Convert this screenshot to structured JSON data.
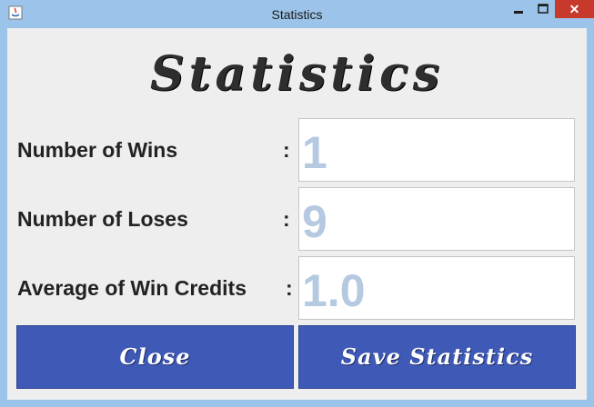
{
  "window": {
    "title": "Statistics",
    "close_glyph": "✕",
    "icons": [
      "java-app-icon",
      "minimize-icon",
      "maximize-icon",
      "close-icon"
    ]
  },
  "heading": "Statistics",
  "stats": [
    {
      "label": "Number of Wins",
      "colon": ":",
      "value": "1"
    },
    {
      "label": "Number of Loses",
      "colon": ":",
      "value": "9"
    },
    {
      "label": "Average of Win Credits",
      "colon": ":",
      "value": "1.0"
    }
  ],
  "buttons": {
    "close": "Close",
    "save": "Save Statistics"
  },
  "colors": {
    "frame": "#9cc4ea",
    "panel": "#eeeeee",
    "button": "#3f59b7",
    "field_text": "#b5c9e0",
    "close_button": "#c7392b"
  }
}
